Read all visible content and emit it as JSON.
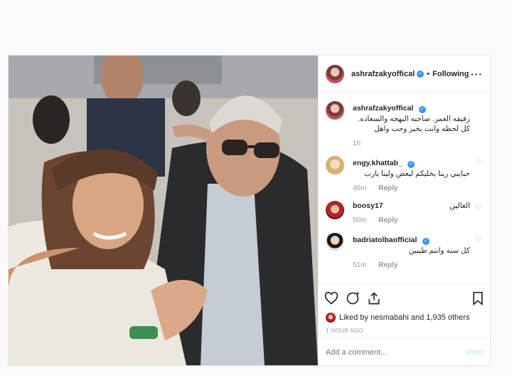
{
  "post": {
    "username": "ashrafzakyoffical",
    "follow_status": "Following",
    "caption": "رفيقه العمر. صاحبه البهجه والسعاده. كل لحظه وانت بخير وحب واهل",
    "caption_time": "1h",
    "likes_text": "Liked by nesmabahi and 1,935 others",
    "time_ago": "1 HOUR AGO",
    "comment_placeholder": "Add a comment...",
    "post_label": "Post"
  },
  "comments": [
    {
      "user": "engy.khattab_",
      "verified": true,
      "text": "حبايبي ربنا يخليكم لبعض ولينا يارب",
      "time": "46m",
      "reply": "Reply"
    },
    {
      "user": "boosy17",
      "verified": false,
      "text": "الغالين",
      "time": "50m",
      "reply": "Reply"
    },
    {
      "user": "badriatolbaofficial",
      "verified": true,
      "text": "كل سنه وانتم طيبين",
      "time": "51m",
      "reply": "Reply"
    }
  ],
  "icons": [
    "more-options-icon",
    "heart-icon",
    "comment-icon",
    "share-icon",
    "bookmark-icon",
    "verified-icon"
  ],
  "colors": {
    "accent": "#3897f0",
    "post_disabled": "#b2dffc"
  }
}
